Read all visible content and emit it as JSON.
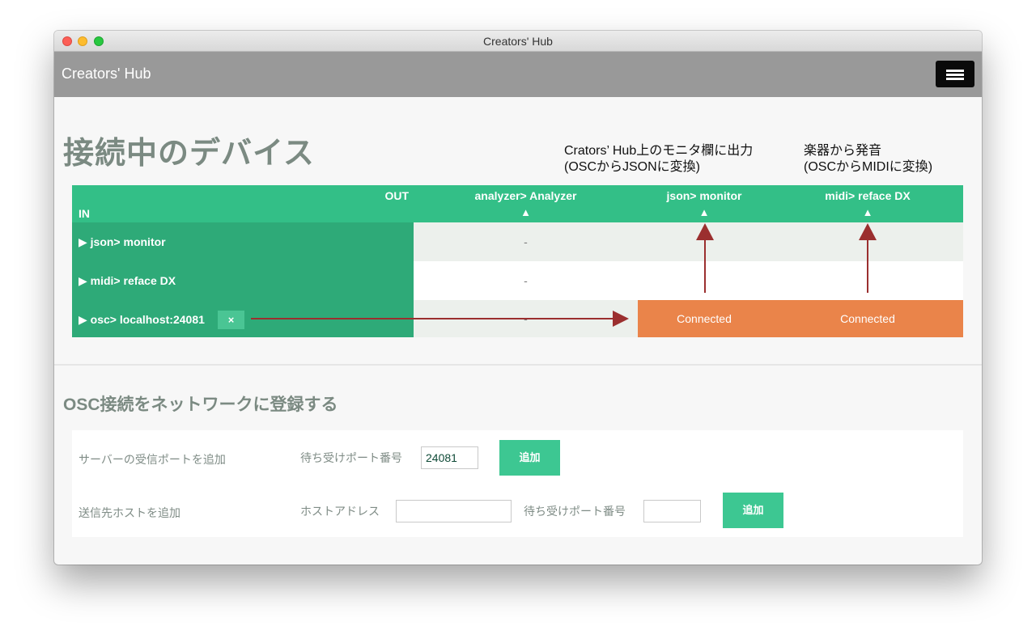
{
  "window": {
    "title": "Creators' Hub"
  },
  "appbar": {
    "brand": "Creators' Hub",
    "menu_icon": "hamburger-menu-icon"
  },
  "page": {
    "title": "接続中のデバイス"
  },
  "annotations": [
    {
      "line1": "Crators’ Hub上のモニタ欄に出力",
      "line2": "(OSCからJSONに変換)"
    },
    {
      "line1": "楽器から発音",
      "line2": "(OSCからMIDIに変換)"
    }
  ],
  "matrix": {
    "out_label": "OUT",
    "in_label": "IN",
    "columns": [
      {
        "label": "analyzer> Analyzer",
        "arrow": "▲"
      },
      {
        "label": "json> monitor",
        "arrow": "▲"
      },
      {
        "label": "midi> reface DX",
        "arrow": "▲"
      }
    ],
    "rows": [
      {
        "label": "▶ json> monitor",
        "cells": [
          "-",
          "",
          ""
        ]
      },
      {
        "label": "▶ midi> reface DX",
        "cells": [
          "-",
          "",
          ""
        ]
      },
      {
        "label": "▶ osc> localhost:24081",
        "remove_label": "×",
        "cells": [
          "-",
          "Connected",
          "Connected"
        ]
      }
    ],
    "colors": {
      "header": "#33bf87",
      "row_header": "#2eaa78",
      "connected": "#ea844a",
      "arrow": "#9b2f2f"
    }
  },
  "osc_section": {
    "title": "OSC接続をネットワークに登録する",
    "server": {
      "label": "サーバーの受信ポートを追加",
      "port_label": "待ち受けポート番号",
      "port_value": "24081",
      "button": "追加"
    },
    "client": {
      "label": "送信先ホストを追加",
      "host_label": "ホストアドレス",
      "host_value": "",
      "port_label": "待ち受けポート番号",
      "port_value": "",
      "button": "追加"
    }
  }
}
